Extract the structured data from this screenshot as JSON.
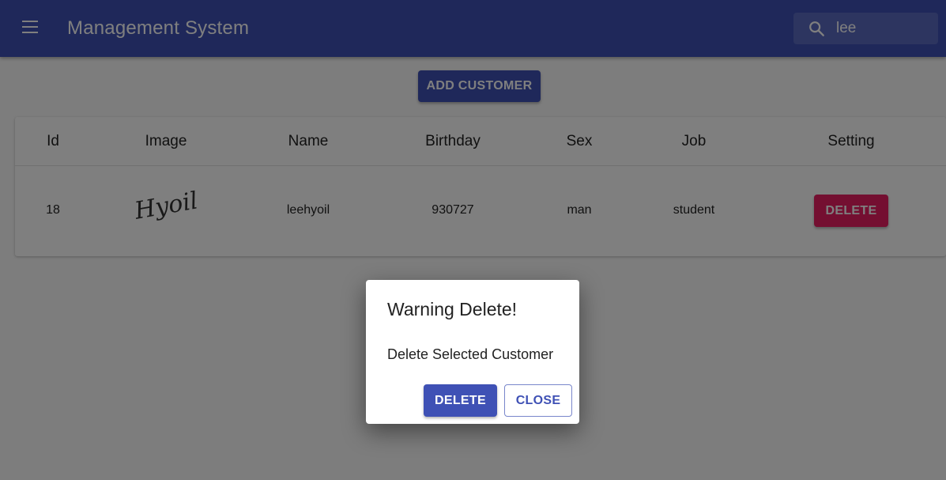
{
  "appbar": {
    "title": "Management System",
    "menu_icon": "menu-icon",
    "search": {
      "icon": "search-icon",
      "value": "lee"
    },
    "color": "#3f51b5"
  },
  "actions": {
    "add_label": "ADD CUSTOMER"
  },
  "table": {
    "columns": [
      "Id",
      "Image",
      "Name",
      "Birthday",
      "Sex",
      "Job",
      "Setting"
    ],
    "rows": [
      {
        "id": "18",
        "image_text": "Hyoil",
        "name": "leehyoil",
        "birthday": "930727",
        "sex": "man",
        "job": "student",
        "setting_label": "DELETE"
      }
    ],
    "delete_color": "#e91e63"
  },
  "dialog": {
    "title": "Warning Delete!",
    "text": "Delete Selected Customer",
    "delete_label": "DELETE",
    "close_label": "CLOSE"
  }
}
